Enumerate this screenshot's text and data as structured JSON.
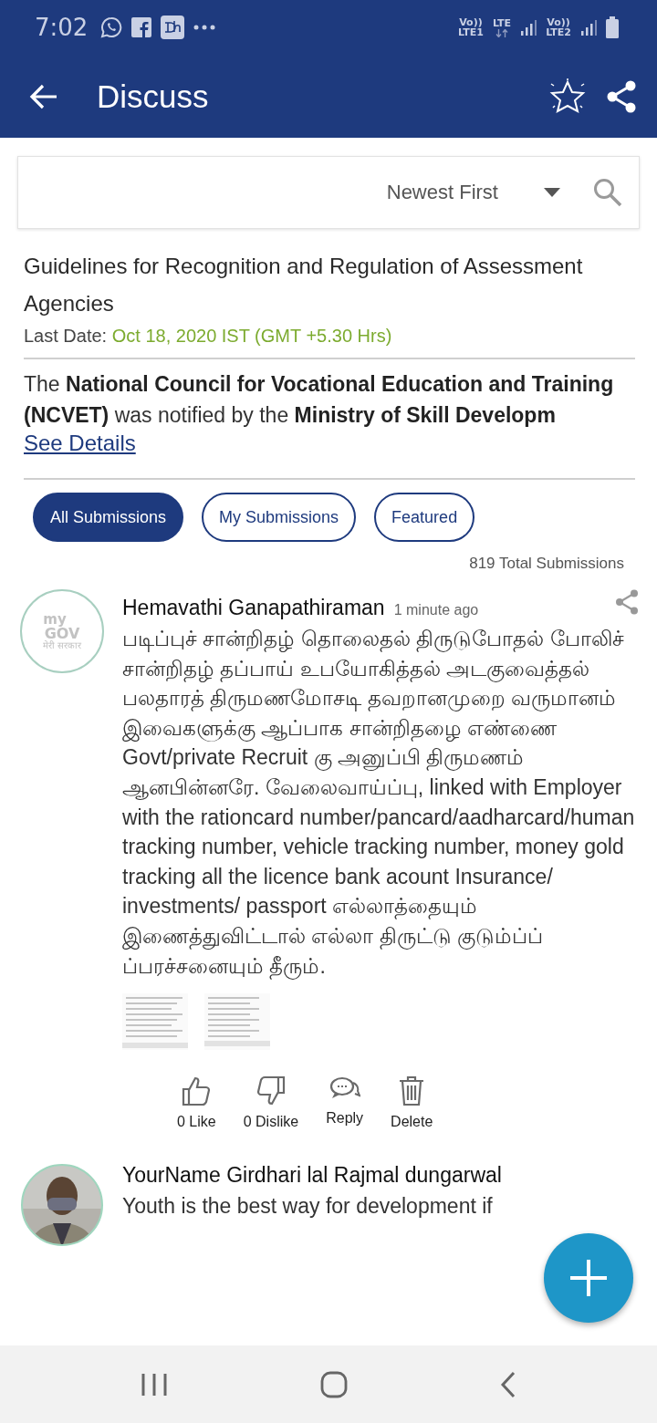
{
  "status_bar": {
    "time": "7:02",
    "sim1_top": "Vo))",
    "sim1_bottom": "LTE1",
    "lte": "LTE",
    "sim2_top": "Vo))",
    "sim2_bottom": "LTE2"
  },
  "app_bar": {
    "title": "Discuss"
  },
  "filter": {
    "sort": "Newest First"
  },
  "topic": {
    "title": "Guidelines for Recognition and Regulation of Assessment Agencies",
    "last_date_label": "Last Date:",
    "last_date": "Oct 18, 2020 IST (GMT +5.30 Hrs)",
    "description": "The **National Council for Vocational Education and Training (NCVET)** was notified by the **Ministry of Skill Developm**",
    "see_details": "See Details"
  },
  "tabs": [
    {
      "label": "All Submissions",
      "selected": true
    },
    {
      "label": "My Submissions",
      "selected": false
    },
    {
      "label": "Featured",
      "selected": false
    }
  ],
  "total": "819 Total Submissions",
  "submissions": [
    {
      "avatar": {
        "kind": "logo",
        "top": "my",
        "middle": "GOV",
        "bottom": "मेरी सरकार"
      },
      "author": "Hemavathi Ganapathiraman",
      "time": "1 minute ago",
      "text": "படிப்புச் சான்றிதழ் தொலைதல் திருடுபோதல் போலிச் சான்றிதழ் தப்பாய் உபயோகித்தல் அடகுவைத்தல் பலதாரத் திருமணமோசடி தவறானமுறை வருமானம் இவைகளுக்கு ஆப்பாக சான்றிதழை எண்ணை Govt/private Recruit கு அனுப்பி திருமணம் ஆனபின்னரே. வேலைவாய்ப்பு, linked with Employer with the rationcard number/pancard/aadharcard/human tracking number, vehicle tracking number, money gold tracking all the licence bank acount Insurance/ investments/ passport எல்லாத்தையும் இணைத்துவிட்டால் எல்லா திருட்டு குடும்ப்ப் ப்பரச்சனையும் தீரும்.",
      "attachments": [
        {
          "kind": "screenshot"
        },
        {
          "kind": "screenshot"
        }
      ],
      "actions": [
        {
          "kind": "like",
          "label": "0 Like"
        },
        {
          "kind": "dislike",
          "label": "0 Dislike"
        },
        {
          "kind": "reply",
          "label": "Reply"
        },
        {
          "kind": "delete",
          "label": "Delete"
        }
      ]
    },
    {
      "author": "YourName Girdhari lal Rajmal dungarwal",
      "text": "Youth is the best way for development if"
    }
  ]
}
